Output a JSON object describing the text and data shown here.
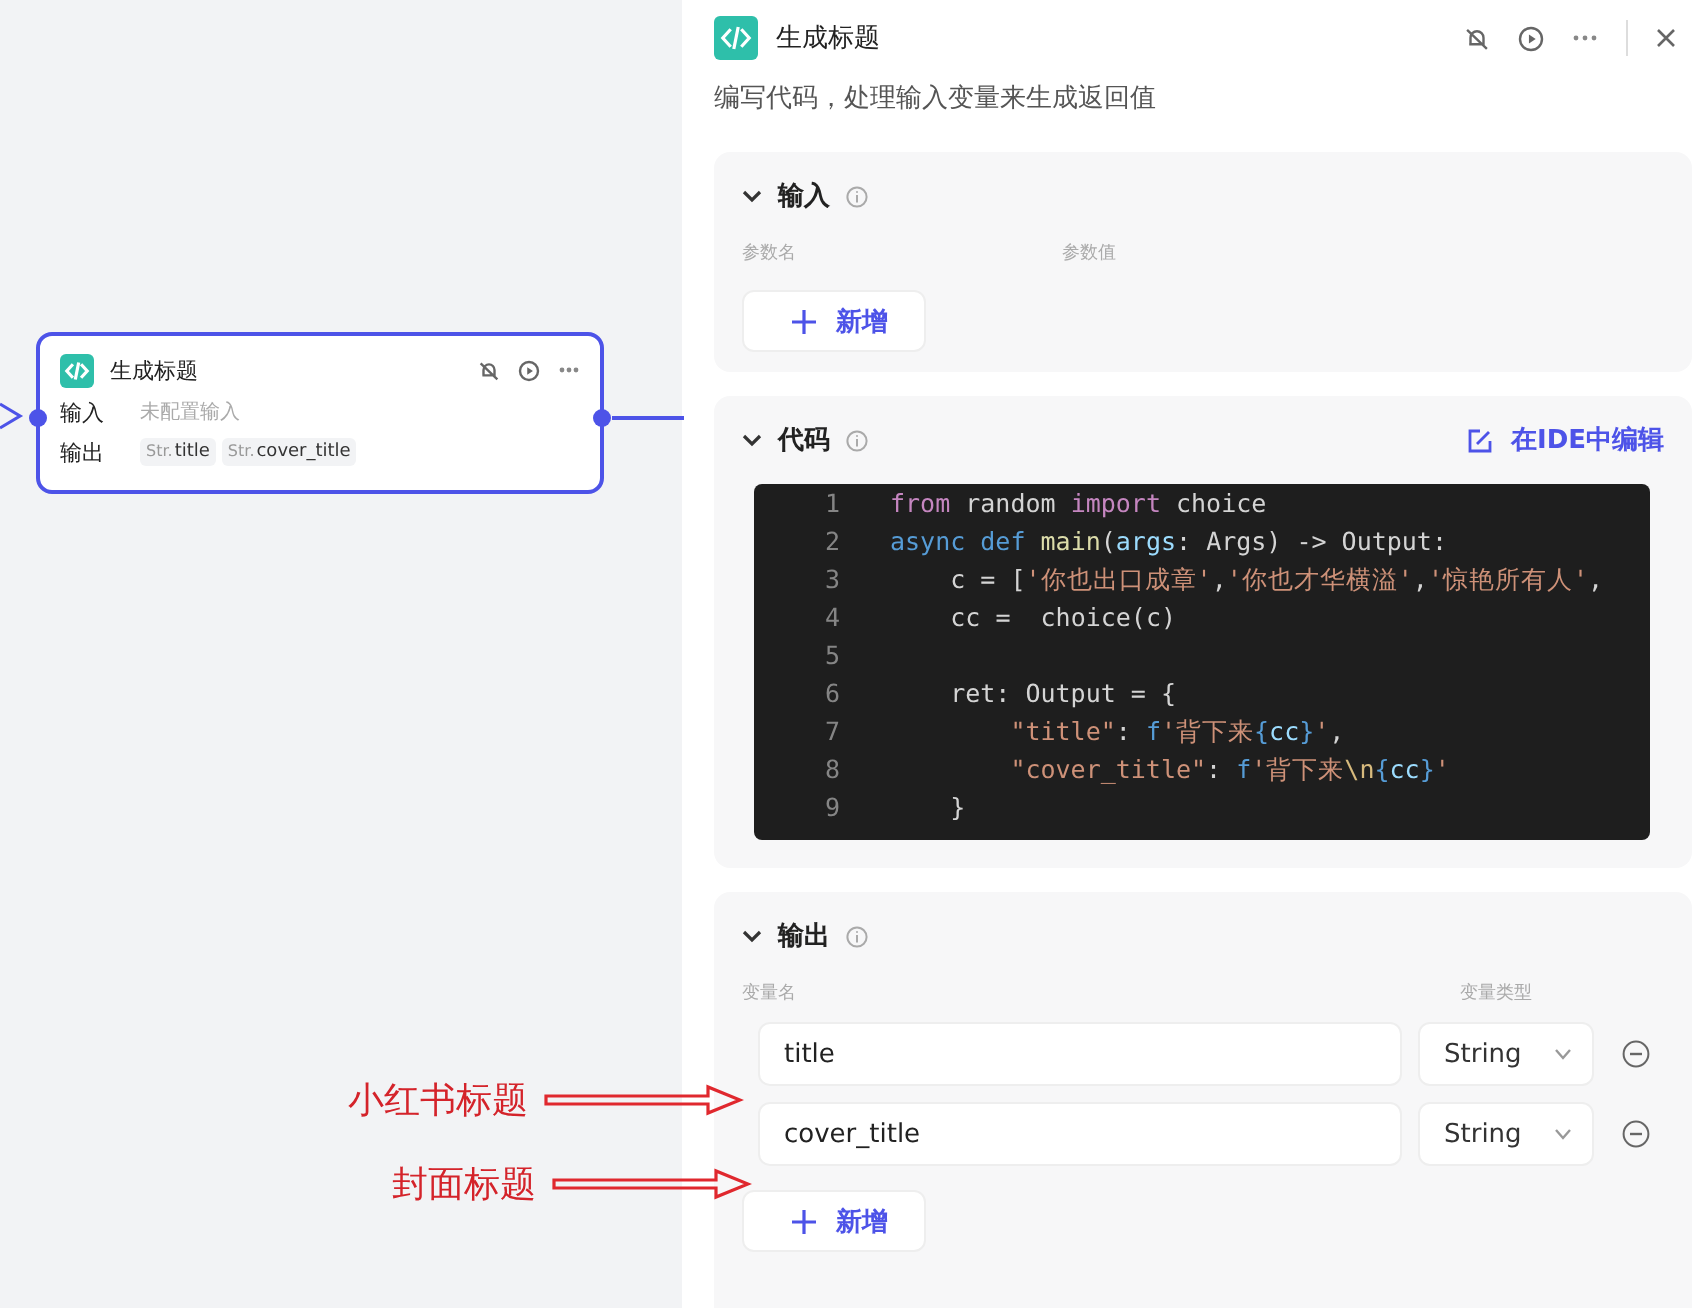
{
  "canvas": {
    "node": {
      "title": "生成标题",
      "input_label": "输入",
      "input_placeholder": "未配置输入",
      "output_label": "输出",
      "outputs": [
        {
          "type": "Str.",
          "name": "title"
        },
        {
          "type": "Str.",
          "name": "cover_title"
        }
      ]
    }
  },
  "panel": {
    "title": "生成标题",
    "description": "编写代码，处理输入变量来生成返回值",
    "input_section": {
      "title": "输入",
      "expanded": true,
      "columns": [
        "参数名",
        "参数值"
      ],
      "add_button": "新增"
    },
    "code_section": {
      "title": "代码",
      "expanded": true,
      "ide_link": "在IDE中编辑",
      "lines": [
        {
          "number": "1",
          "tokens": [
            {
              "text": "from",
              "kind": "keyword"
            },
            {
              "text": " random ",
              "kind": "plain"
            },
            {
              "text": "import",
              "kind": "keyword"
            },
            {
              "text": " choice",
              "kind": "plain"
            }
          ]
        },
        {
          "number": "2",
          "tokens": [
            {
              "text": "async ",
              "kind": "decl"
            },
            {
              "text": "def ",
              "kind": "decl"
            },
            {
              "text": "main",
              "kind": "function"
            },
            {
              "text": "(",
              "kind": "plain"
            },
            {
              "text": "args",
              "kind": "variable"
            },
            {
              "text": ": Args) -> Output:",
              "kind": "plain"
            }
          ]
        },
        {
          "number": "3",
          "tokens": [
            {
              "text": "    c ",
              "kind": "plain"
            },
            {
              "text": "=",
              "kind": "operator"
            },
            {
              "text": " [",
              "kind": "plain"
            },
            {
              "text": "'你也出口成章'",
              "kind": "string"
            },
            {
              "text": ",",
              "kind": "plain"
            },
            {
              "text": "'你也才华横溢'",
              "kind": "string"
            },
            {
              "text": ",",
              "kind": "plain"
            },
            {
              "text": "'惊艳所有人'",
              "kind": "string"
            },
            {
              "text": ",",
              "kind": "plain"
            }
          ]
        },
        {
          "number": "4",
          "tokens": [
            {
              "text": "    cc ",
              "kind": "plain"
            },
            {
              "text": "=",
              "kind": "operator"
            },
            {
              "text": "  choice(c)",
              "kind": "plain"
            }
          ]
        },
        {
          "number": "5"
        },
        {
          "number": "6",
          "tokens": [
            {
              "text": "    ret: Output ",
              "kind": "plain"
            },
            {
              "text": "=",
              "kind": "operator"
            },
            {
              "text": " {",
              "kind": "plain"
            }
          ]
        },
        {
          "number": "7",
          "tokens": [
            {
              "text": "        \"title\"",
              "kind": "string"
            },
            {
              "text": ": ",
              "kind": "plain"
            },
            {
              "text": "f",
              "kind": "decl"
            },
            {
              "text": "'背下来",
              "kind": "string"
            },
            {
              "text": "{",
              "kind": "decl"
            },
            {
              "text": "cc",
              "kind": "variable"
            },
            {
              "text": "}",
              "kind": "decl"
            },
            {
              "text": "'",
              "kind": "string"
            },
            {
              "text": ",",
              "kind": "plain"
            }
          ]
        },
        {
          "number": "8",
          "tokens": [
            {
              "text": "        \"cover_title\"",
              "kind": "string"
            },
            {
              "text": ": ",
              "kind": "plain"
            },
            {
              "text": "f",
              "kind": "decl"
            },
            {
              "text": "'背下来",
              "kind": "string"
            },
            {
              "text": "\\n",
              "kind": "escape"
            },
            {
              "text": "{",
              "kind": "decl"
            },
            {
              "text": "cc",
              "kind": "variable"
            },
            {
              "text": "}",
              "kind": "decl"
            },
            {
              "text": "'",
              "kind": "string"
            }
          ]
        },
        {
          "number": "9",
          "tokens": [
            {
              "text": "    }",
              "kind": "plain"
            }
          ]
        }
      ]
    },
    "output_section": {
      "title": "输出",
      "expanded": true,
      "columns": [
        "变量名",
        "变量类型"
      ],
      "variables": [
        {
          "name": "title",
          "type": "String"
        },
        {
          "name": "cover_title",
          "type": "String"
        }
      ],
      "add_button": "新增"
    }
  },
  "annotations": [
    {
      "text": "小红书标题"
    },
    {
      "text": "封面标题"
    }
  ]
}
